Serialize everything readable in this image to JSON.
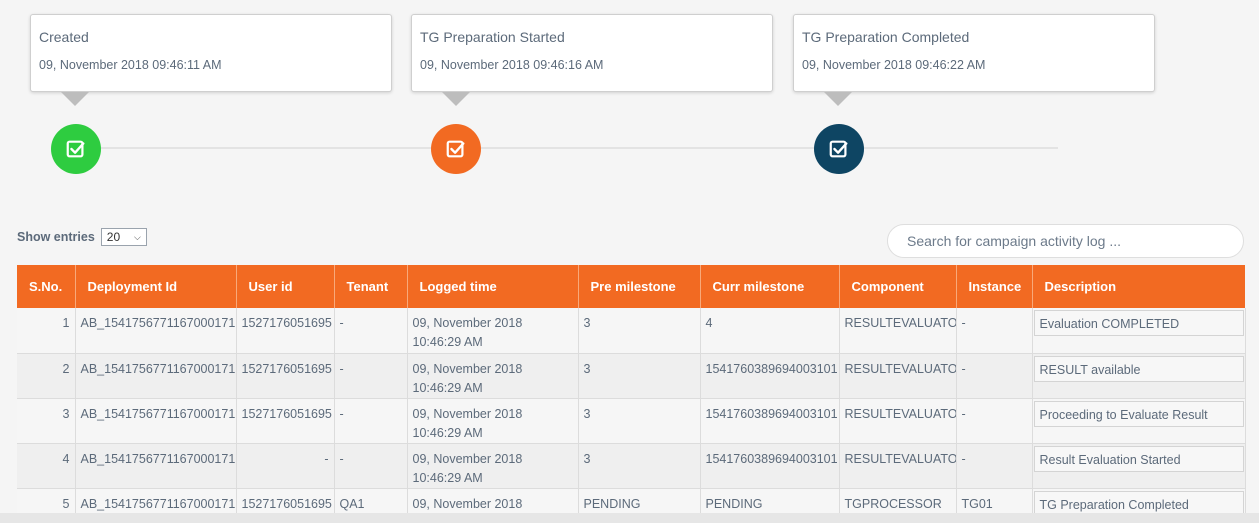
{
  "timeline": {
    "steps": [
      {
        "title": "Created",
        "time": "09, November 2018 09:46:11 AM",
        "color": "#2ecc40",
        "icon": "check-square-icon"
      },
      {
        "title": "TG Preparation Started",
        "time": "09, November 2018 09:46:16 AM",
        "color": "#f26a22",
        "icon": "check-square-icon"
      },
      {
        "title": "TG Preparation Completed",
        "time": "09, November 2018 09:46:22 AM",
        "color": "#0e4563",
        "icon": "check-square-icon"
      }
    ]
  },
  "controls": {
    "show_entries_label": "Show entries",
    "entries_value": "20",
    "search_placeholder": "Search for campaign activity log ..."
  },
  "table": {
    "headers": [
      "S.No.",
      "Deployment Id",
      "User id",
      "Tenant",
      "Logged time",
      "Pre milestone",
      "Curr milestone",
      "Component",
      "Instance",
      "Description"
    ],
    "rows": [
      [
        "1",
        "AB_1541756771167000171",
        "1527176051695",
        "-",
        "09, November 2018 10:46:29 AM",
        "3",
        "4",
        "RESULTEVALUATOR",
        "-",
        "Evaluation COMPLETED"
      ],
      [
        "2",
        "AB_1541756771167000171",
        "1527176051695",
        "-",
        "09, November 2018 10:46:29 AM",
        "3",
        "1541760389694003101",
        "RESULTEVALUATOR",
        "-",
        "RESULT available"
      ],
      [
        "3",
        "AB_1541756771167000171",
        "1527176051695",
        "-",
        "09, November 2018 10:46:29 AM",
        "3",
        "1541760389694003101",
        "RESULTEVALUATOR",
        "-",
        "Proceeding to Evaluate Result"
      ],
      [
        "4",
        "AB_1541756771167000171",
        "-",
        "-",
        "09, November 2018 10:46:29 AM",
        "3",
        "1541760389694003101",
        "RESULTEVALUATOR",
        "-",
        "Result Evaluation Started"
      ],
      [
        "5",
        "AB_1541756771167000171",
        "1527176051695",
        "QA1",
        "09, November 2018",
        "PENDING",
        "PENDING",
        "TGPROCESSOR",
        "TG01",
        "TG Preparation Completed"
      ]
    ]
  },
  "colors": {
    "header_bg": "#f26a22",
    "accent_green": "#2ecc40",
    "accent_orange": "#f26a22",
    "accent_navy": "#0e4563"
  }
}
